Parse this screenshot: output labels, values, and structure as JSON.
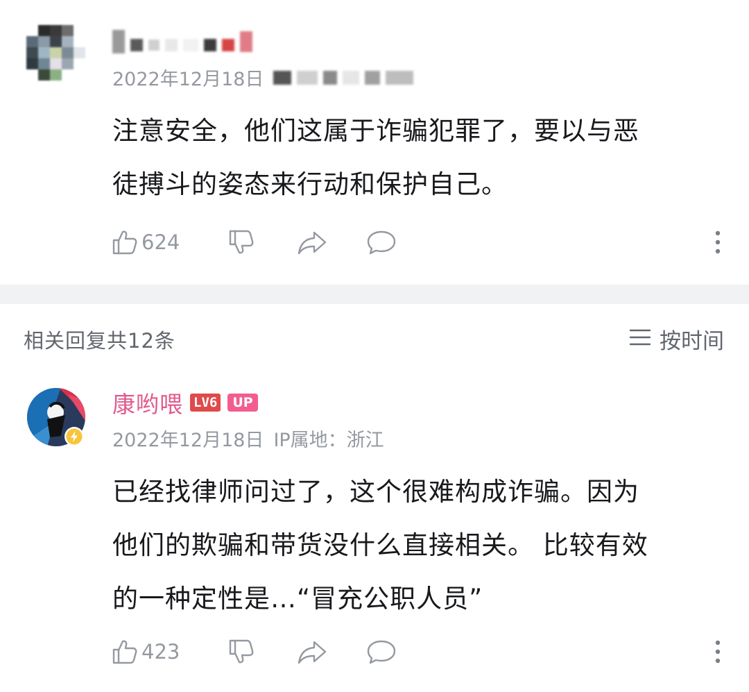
{
  "comment1": {
    "date": "2022年12月18日",
    "content_lines": [
      "注意安全，他们这属于诈骗犯罪了，要以与恶",
      "徒搏斗的姿态来行动和保护自己。"
    ],
    "like_count": "624"
  },
  "replies_header": {
    "count_label": "相关回复共12条",
    "sort_label": "按时间"
  },
  "comment2": {
    "username": "康哟喂",
    "level_badge": "LV6",
    "up_badge": "UP",
    "date": "2022年12月18日",
    "ip_label": "IP属地：浙江",
    "content_lines": [
      "已经找律师问过了，这个很难构成诈骗。因为",
      "他们的欺骗和带货没什么直接相关。 比较有效",
      "的一种定性是…“冒充公职人员”"
    ],
    "like_count": "423"
  },
  "icons": [
    "thumb-up-icon",
    "thumb-down-icon",
    "share-icon",
    "comment-icon",
    "more-vertical-icon",
    "sort-lines-icon",
    "lightning-badge-icon"
  ],
  "colors": {
    "username": "#e05c8d",
    "level_badge": "#e04a4a",
    "up_badge": "#f25d8e",
    "meta_text": "#9499a0",
    "divider": "#f1f2f3"
  }
}
